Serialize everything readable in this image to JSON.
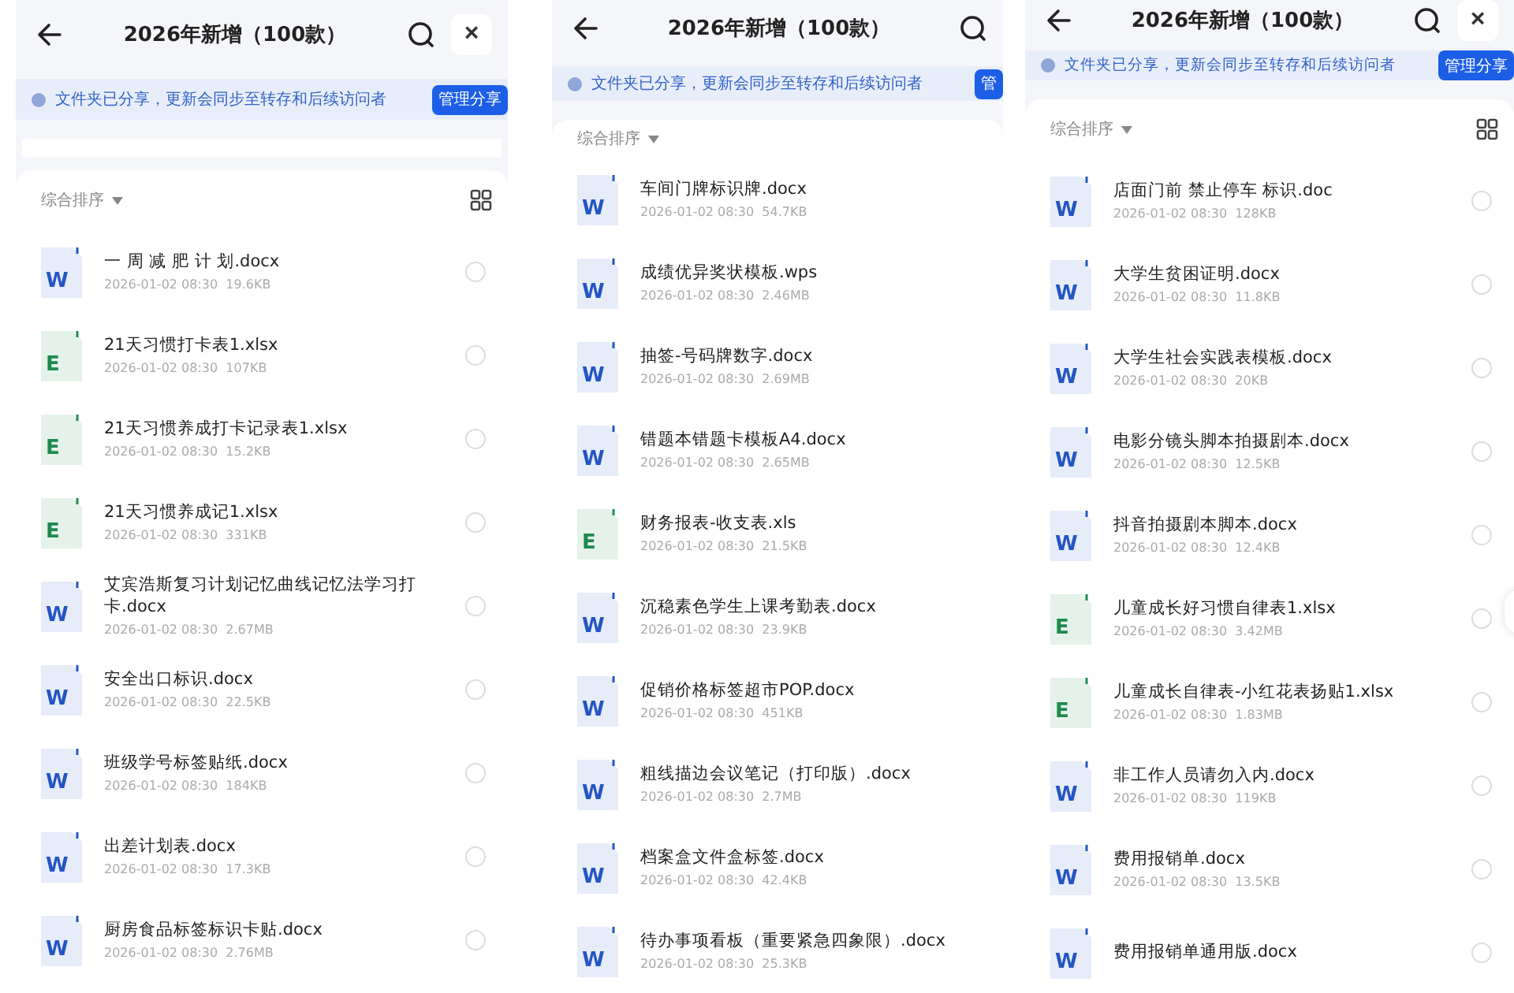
{
  "panels": [
    {
      "title": "2026年新增（100款）",
      "close": "×",
      "notice": "文件夹已分享，更新会同步至转存和后续访问者",
      "notice_button": "管理分享",
      "sort": "综合排序",
      "grid_toggle": true,
      "files": [
        {
          "kind": "word",
          "icon_letter": "W",
          "name": "一 周 减 肥 计 划.docx",
          "meta": "2026-01-02 08:30  19.6KB",
          "selected": false
        },
        {
          "kind": "excel",
          "icon_letter": "E",
          "name": "21天习惯打卡表1.xlsx",
          "meta": "2026-01-02 08:30  107KB",
          "selected": false
        },
        {
          "kind": "excel",
          "icon_letter": "E",
          "name": "21天习惯养成打卡记录表1.xlsx",
          "meta": "2026-01-02 08:30  15.2KB",
          "selected": false
        },
        {
          "kind": "excel",
          "icon_letter": "E",
          "name": "21天习惯养成记1.xlsx",
          "meta": "2026-01-02 08:30  331KB",
          "selected": false
        },
        {
          "kind": "word",
          "icon_letter": "W",
          "name": "艾宾浩斯复习计划记忆曲线记忆法学习打卡.docx",
          "meta": "2026-01-02 08:30  2.67MB",
          "selected": false
        },
        {
          "kind": "word",
          "icon_letter": "W",
          "name": "安全出口标识.docx",
          "meta": "2026-01-02 08:30  22.5KB",
          "selected": false
        },
        {
          "kind": "word",
          "icon_letter": "W",
          "name": "班级学号标签贴纸.docx",
          "meta": "2026-01-02 08:30  184KB",
          "selected": false
        },
        {
          "kind": "word",
          "icon_letter": "W",
          "name": "出差计划表.docx",
          "meta": "2026-01-02 08:30  17.3KB",
          "selected": false
        },
        {
          "kind": "word",
          "icon_letter": "W",
          "name": "厨房食品标签标识卡贴.docx",
          "meta": "2026-01-02 08:30  2.76MB",
          "selected": false
        }
      ]
    },
    {
      "title": "2026年新增（100款）",
      "notice": "文件夹已分享，更新会同步至转存和后续访问者",
      "notice_button": "管",
      "sort": "综合排序",
      "grid_toggle": false,
      "files": [
        {
          "kind": "word",
          "icon_letter": "W",
          "name": "车间门牌标识牌.docx",
          "meta": "2026-01-02 08:30  54.7KB"
        },
        {
          "kind": "word",
          "icon_letter": "W",
          "name": "成绩优异奖状模板.wps",
          "meta": "2026-01-02 08:30  2.46MB"
        },
        {
          "kind": "word",
          "icon_letter": "W",
          "name": "抽签-号码牌数字.docx",
          "meta": "2026-01-02 08:30  2.69MB"
        },
        {
          "kind": "word",
          "icon_letter": "W",
          "name": "错题本错题卡模板A4.docx",
          "meta": "2026-01-02 08:30  2.65MB"
        },
        {
          "kind": "excel",
          "icon_letter": "E",
          "name": "财务报表-收支表.xls",
          "meta": "2026-01-02 08:30  21.5KB"
        },
        {
          "kind": "word",
          "icon_letter": "W",
          "name": "沉稳素色学生上课考勤表.docx",
          "meta": "2026-01-02 08:30  23.9KB"
        },
        {
          "kind": "word",
          "icon_letter": "W",
          "name": "促销价格标签超市POP.docx",
          "meta": "2026-01-02 08:30  451KB"
        },
        {
          "kind": "word",
          "icon_letter": "W",
          "name": "粗线描边会议笔记（打印版）.docx",
          "meta": "2026-01-02 08:30  2.7MB"
        },
        {
          "kind": "word",
          "icon_letter": "W",
          "name": "档案盒文件盒标签.docx",
          "meta": "2026-01-02 08:30  42.4KB"
        },
        {
          "kind": "word",
          "icon_letter": "W",
          "name": "待办事项看板（重要紧急四象限）.docx",
          "meta": "2026-01-02 08:30  25.3KB"
        }
      ]
    },
    {
      "title": "2026年新增（100款）",
      "close": "×",
      "notice": "文件夹已分享，更新会同步至转存和后续访问者",
      "notice_button": "管理分享",
      "sort": "综合排序",
      "grid_toggle": true,
      "files": [
        {
          "kind": "word",
          "icon_letter": "W",
          "name": "店面门前 禁止停车 标识.doc",
          "meta": "2026-01-02 08:30  128KB",
          "selected": false
        },
        {
          "kind": "word",
          "icon_letter": "W",
          "name": "大学生贫困证明.docx",
          "meta": "2026-01-02 08:30  11.8KB",
          "selected": false
        },
        {
          "kind": "word",
          "icon_letter": "W",
          "name": "大学生社会实践表模板.docx",
          "meta": "2026-01-02 08:30  20KB",
          "selected": false
        },
        {
          "kind": "word",
          "icon_letter": "W",
          "name": "电影分镜头脚本拍摄剧本.docx",
          "meta": "2026-01-02 08:30  12.5KB",
          "selected": false
        },
        {
          "kind": "word",
          "icon_letter": "W",
          "name": "抖音拍摄剧本脚本.docx",
          "meta": "2026-01-02 08:30  12.4KB",
          "selected": false
        },
        {
          "kind": "excel",
          "icon_letter": "E",
          "name": "儿童成长好习惯自律表1.xlsx",
          "meta": "2026-01-02 08:30  3.42MB",
          "selected": false
        },
        {
          "kind": "excel",
          "icon_letter": "E",
          "name": "儿童成长自律表-小红花表扬贴1.xlsx",
          "meta": "2026-01-02 08:30  1.83MB",
          "selected": false
        },
        {
          "kind": "word",
          "icon_letter": "W",
          "name": "非工作人员请勿入内.docx",
          "meta": "2026-01-02 08:30  119KB",
          "selected": false
        },
        {
          "kind": "word",
          "icon_letter": "W",
          "name": "费用报销单.docx",
          "meta": "2026-01-02 08:30  13.5KB",
          "selected": false
        },
        {
          "kind": "word",
          "icon_letter": "W",
          "name": "费用报销单通用版.docx",
          "selected": false
        }
      ]
    }
  ]
}
